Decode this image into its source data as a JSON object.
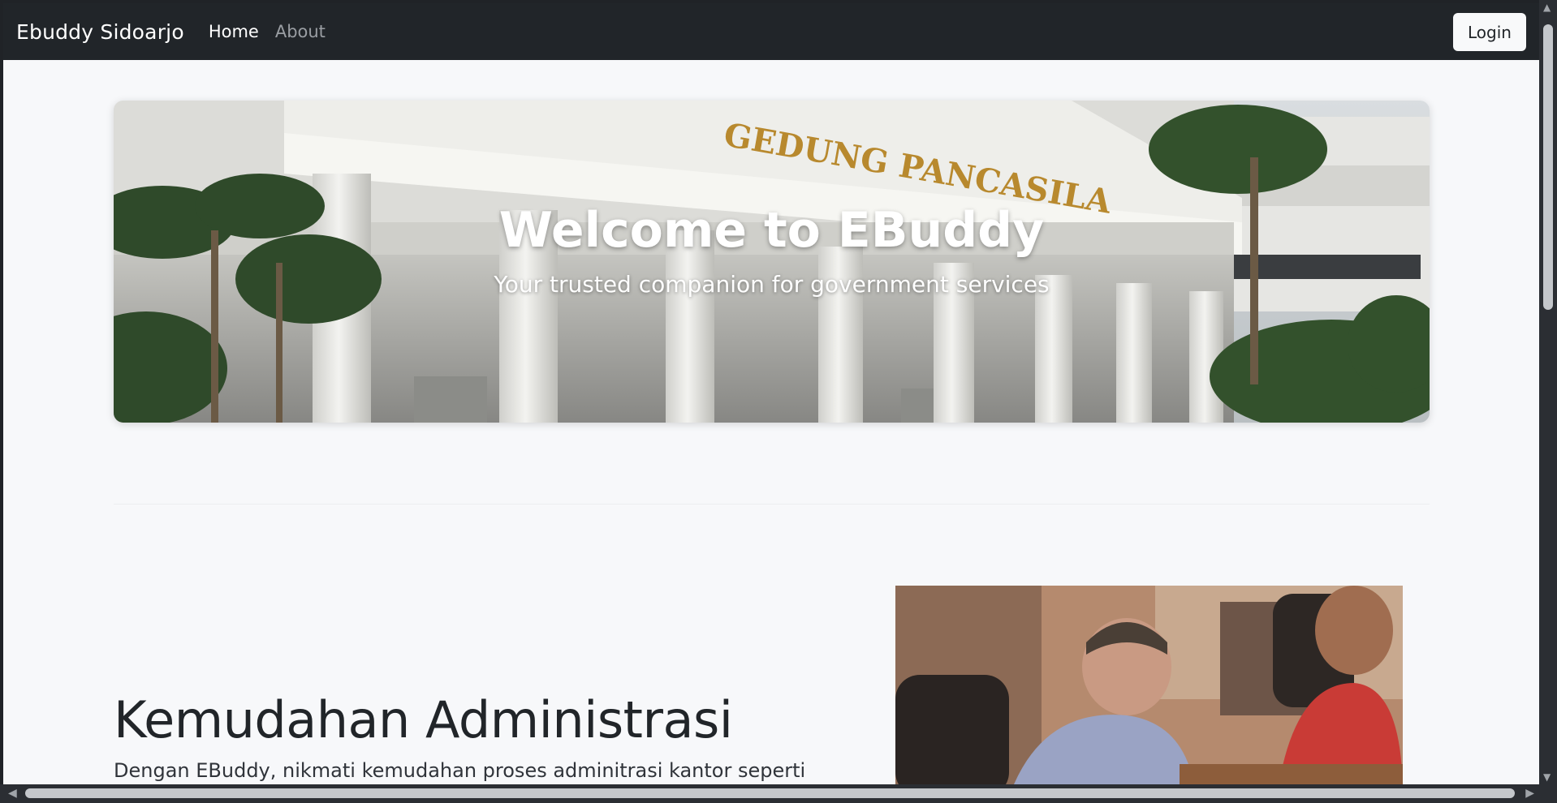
{
  "navbar": {
    "brand": "Ebuddy Sidoarjo",
    "links": [
      {
        "label": "Home"
      },
      {
        "label": "About"
      }
    ],
    "login_label": "Login"
  },
  "hero": {
    "title": "Welcome to EBuddy",
    "subtitle": "Your trusted companion for government services",
    "building_sign": "GEDUNG PANCASILA"
  },
  "feature": {
    "heading": "Kemudahan Administrasi",
    "text": "Dengan EBuddy, nikmati kemudahan proses adminitrasi kantor seperti"
  },
  "colors": {
    "navbar_bg": "#212529",
    "page_bg": "#f7f8fa",
    "text_dark": "#212529"
  }
}
